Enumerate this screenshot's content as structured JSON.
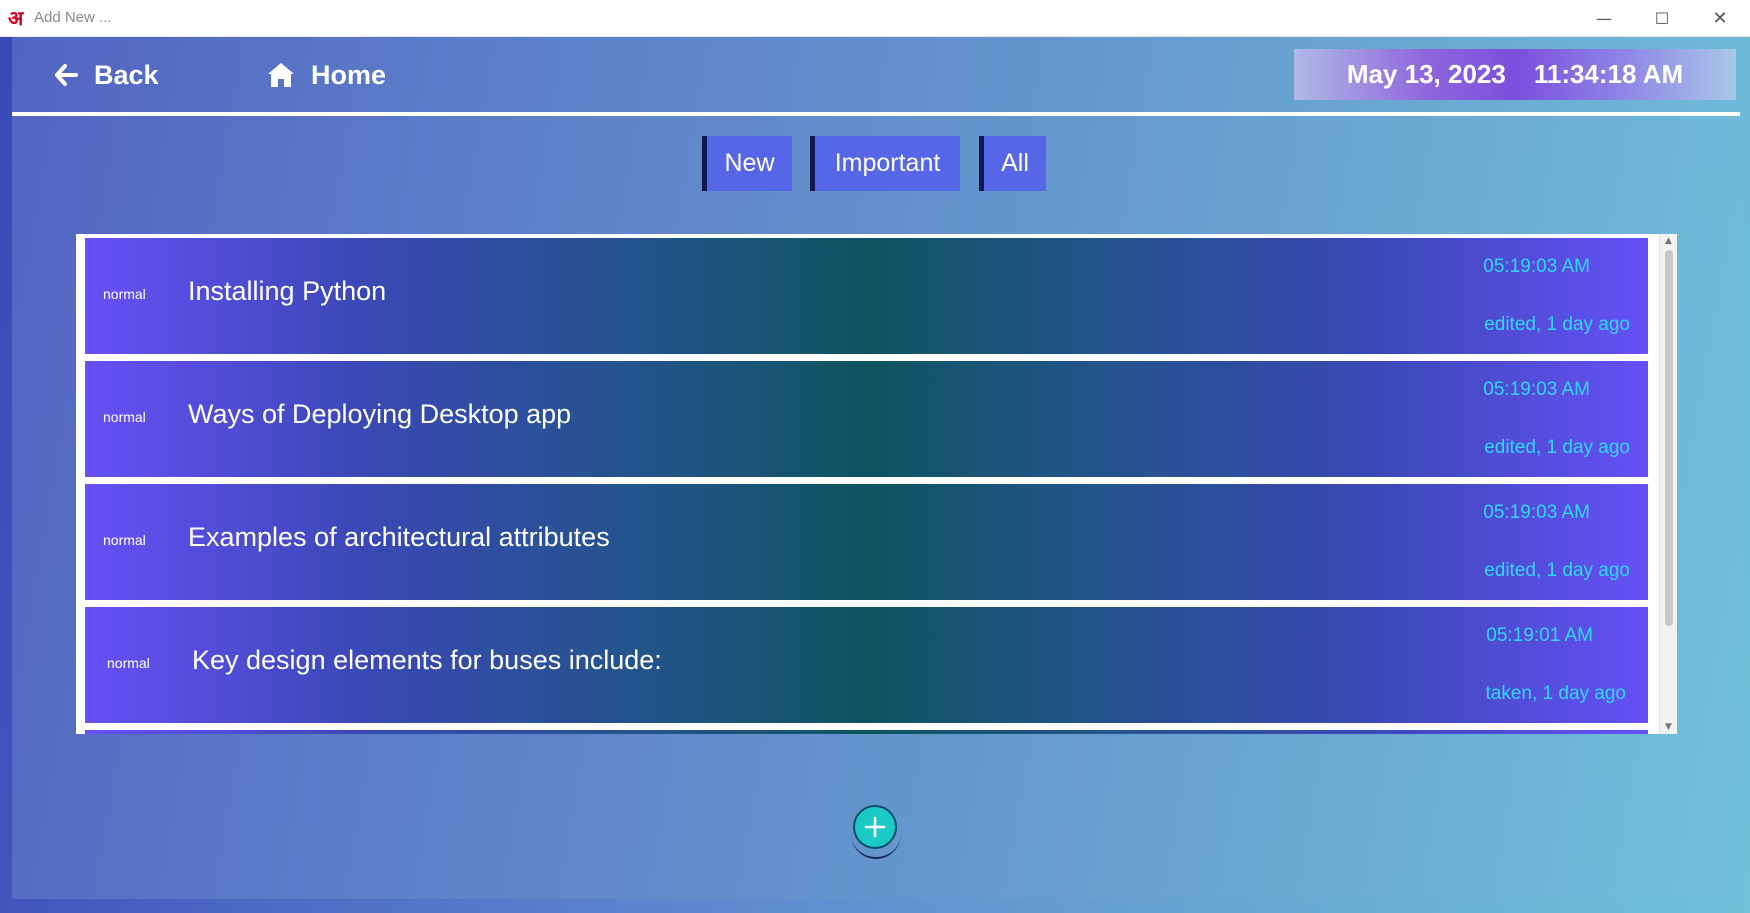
{
  "window": {
    "logo_text": "अ",
    "title": "Add New ...",
    "minimize_glyph": "—",
    "maximize_glyph": "☐",
    "close_glyph": "✕"
  },
  "nav": {
    "back_label": "Back",
    "back_icon": "arrow-left-icon",
    "home_label": "Home",
    "home_icon": "home-icon",
    "date": "May 13, 2023",
    "time": "11:34:18 AM"
  },
  "tabs": [
    {
      "label": "New"
    },
    {
      "label": "Important"
    },
    {
      "label": "All"
    }
  ],
  "notes": [
    {
      "priority": "normal",
      "title": "Installing Python",
      "time": "05:19:03 AM",
      "status": "edited, 1 day ago"
    },
    {
      "priority": "normal",
      "title": "Ways of Deploying Desktop app",
      "time": "05:19:03 AM",
      "status": "edited, 1 day ago"
    },
    {
      "priority": "normal",
      "title": "Examples of architectural attributes",
      "time": "05:19:03 AM",
      "status": "edited, 1 day ago"
    },
    {
      "priority": "normal",
      "title": "Key design elements for buses include:",
      "time": "05:19:01 AM",
      "status": "taken, 1 day ago"
    }
  ],
  "colors": {
    "accent": "#5566e6",
    "tab_border": "#101850",
    "timestamp": "#2fd8ff",
    "add_button": "#1ccbc6"
  },
  "add_button": {
    "icon": "plus-icon"
  }
}
